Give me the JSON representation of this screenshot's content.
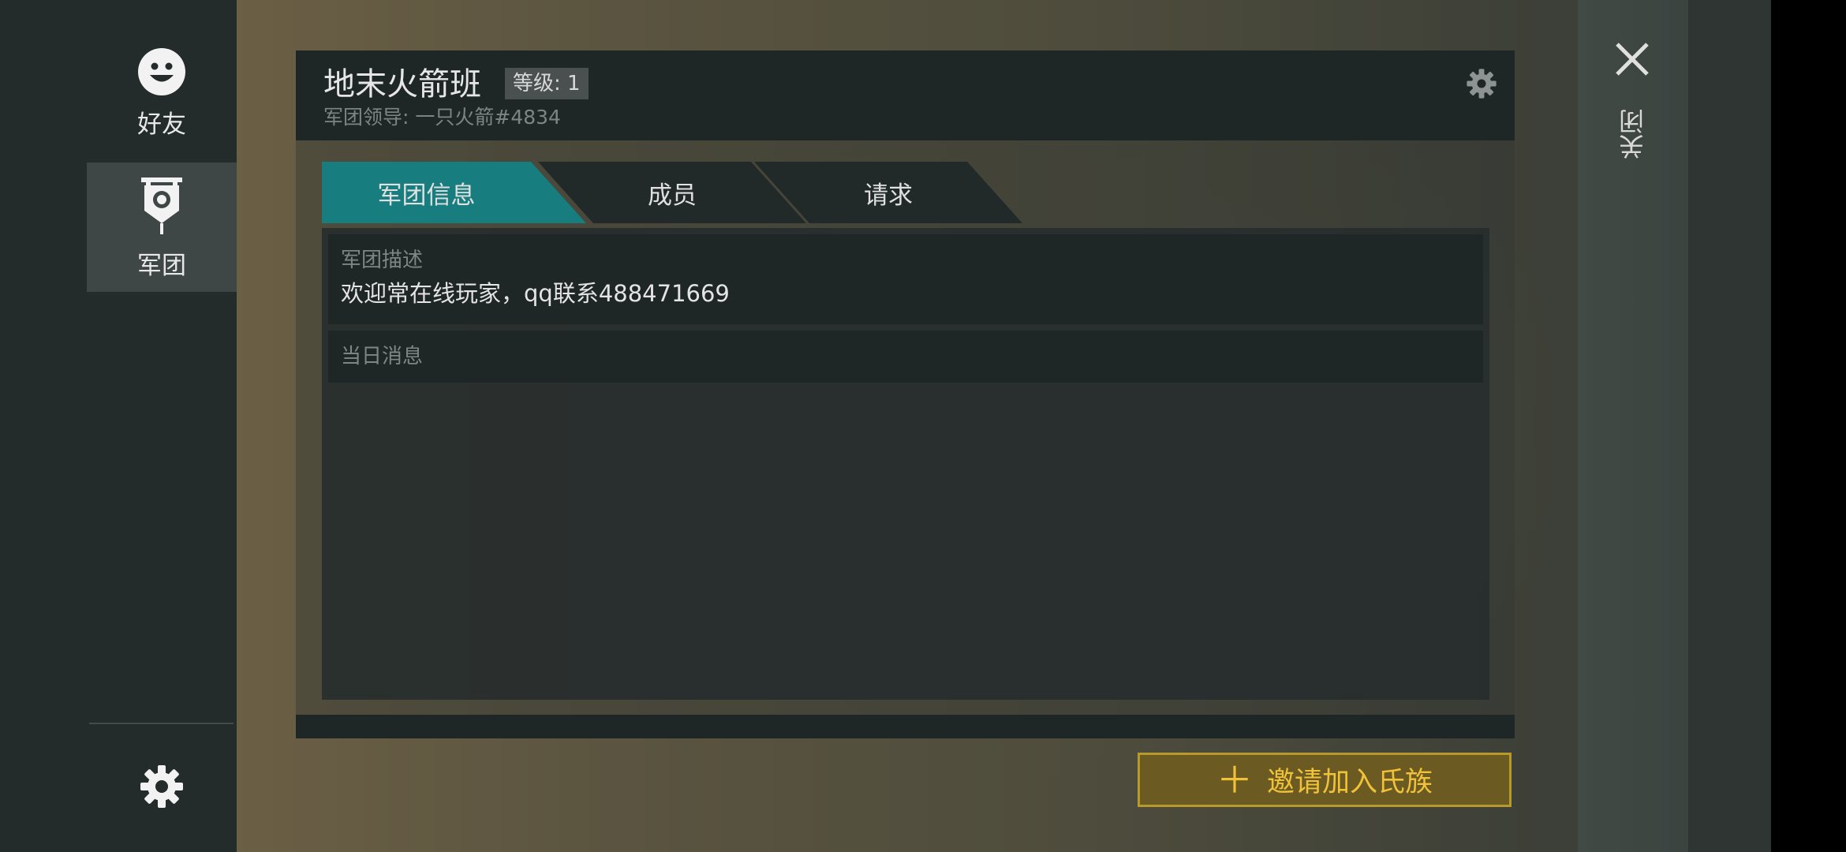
{
  "sidebar": {
    "items": [
      {
        "label": "好友",
        "icon": "smiley-face-icon"
      },
      {
        "label": "军团",
        "icon": "clan-banner-icon",
        "active": true
      }
    ],
    "settings_icon": "gear-icon"
  },
  "clan": {
    "name": "地末火箭班",
    "level_badge": "等级: 1",
    "leader_line": "军团领导: 一只火箭#4834",
    "settings_icon": "gear-icon"
  },
  "tabs": [
    {
      "label": "军团信息",
      "active": true
    },
    {
      "label": "成员",
      "active": false
    },
    {
      "label": "请求",
      "active": false
    }
  ],
  "info": {
    "description_title": "军团描述",
    "description_text": "欢迎常在线玩家，qq联系488471669",
    "motd_title": "当日消息"
  },
  "invite_button": {
    "plus": "＋",
    "label": "邀请加入氏族"
  },
  "close": {
    "icon": "close-icon",
    "label": "关闭"
  },
  "colors": {
    "tab_active": "#177d7e",
    "tab_inactive": "#222929",
    "invite_text": "#f0c23a",
    "invite_border": "#b89a2c"
  }
}
